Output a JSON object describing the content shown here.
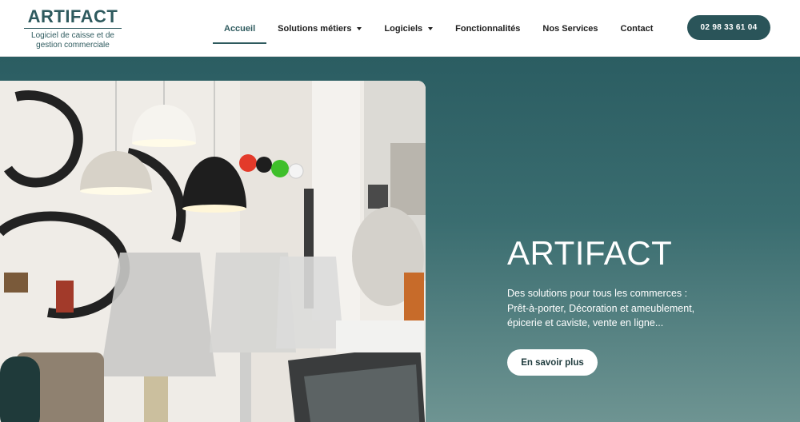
{
  "brand": {
    "name": "ARTIFACT",
    "tagline_line1": "Logiciel de caisse et de",
    "tagline_line2": "gestion commerciale",
    "color": "#2e5a5e"
  },
  "nav": {
    "items": [
      {
        "label": "Accueil",
        "active": true,
        "has_dropdown": false
      },
      {
        "label": "Solutions métiers",
        "active": false,
        "has_dropdown": true
      },
      {
        "label": "Logiciels",
        "active": false,
        "has_dropdown": true
      },
      {
        "label": "Fonctionnalités",
        "active": false,
        "has_dropdown": false
      },
      {
        "label": "Nos Services",
        "active": false,
        "has_dropdown": false
      },
      {
        "label": "Contact",
        "active": false,
        "has_dropdown": false
      }
    ]
  },
  "header": {
    "phone_label": "02 98 33 61 04"
  },
  "hero": {
    "title": "ARTIFACT",
    "text_line1": "Des solutions pour tous les commerces :",
    "text_line2": "Prêt-à-porter, Décoration et ameublement,",
    "text_line3": "épicerie et caviste, vente en ligne...",
    "cta_label": "En savoir plus",
    "background_color": "#2b5d62"
  },
  "icons": {
    "dropdown": "chevron-down-icon"
  }
}
